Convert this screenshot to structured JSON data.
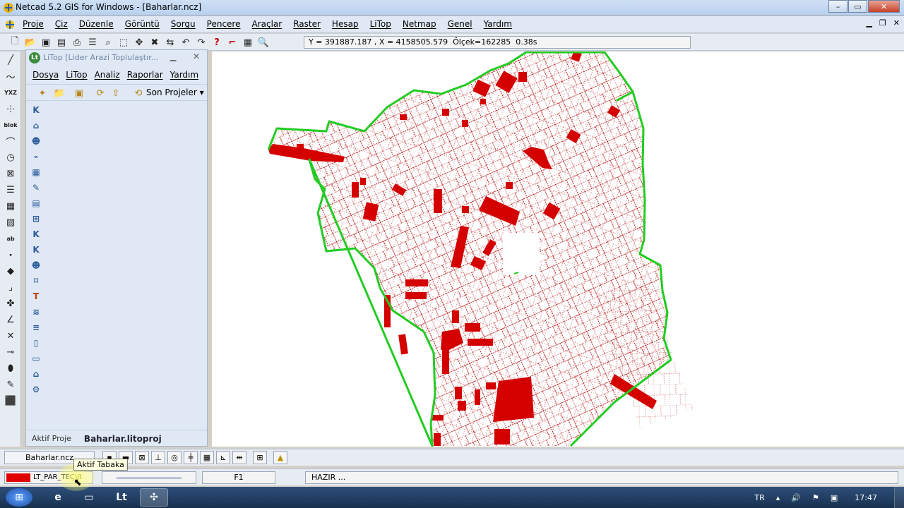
{
  "window": {
    "title": "Netcad 5.2 GIS for Windows - [Baharlar.ncz]",
    "min": "–",
    "max": "▭",
    "close": "✕"
  },
  "menubar": {
    "items": [
      "Proje",
      "Çiz",
      "Düzenle",
      "Görüntü",
      "Sorgu",
      "Pencere",
      "Araçlar",
      "Raster",
      "Hesap",
      "LiTop",
      "Netmap",
      "Genel",
      "Yardım"
    ]
  },
  "toolbar": {
    "coordinates": "Y = 391887.187 , X = 4158505.579  Ölçek=162285  0.38s"
  },
  "litop_panel": {
    "title": "LiTop [Lider Arazi Toplulaştır...",
    "menu": [
      "Dosya",
      "LiTop",
      "Analiz",
      "Raporlar",
      "Yardım"
    ],
    "recent_projects": "Son Projeler",
    "active_project_label": "Aktif Proje",
    "active_project_value": "Baharlar.litoproj"
  },
  "bottombar": {
    "file_tab": "Baharlar.ncz"
  },
  "statusbar": {
    "layer_name": "LT_PAR_TEÇVI",
    "layer_color": "#e00000",
    "function_key": "F1",
    "message": "HAZIR ...",
    "tooltip": "Aktif Tabaka"
  },
  "taskbar": {
    "language": "TR",
    "time": "17:47"
  },
  "colors": {
    "parcel_fill": "#d40000",
    "boundary": "#22cc22",
    "parcel_line": "#b00000"
  }
}
